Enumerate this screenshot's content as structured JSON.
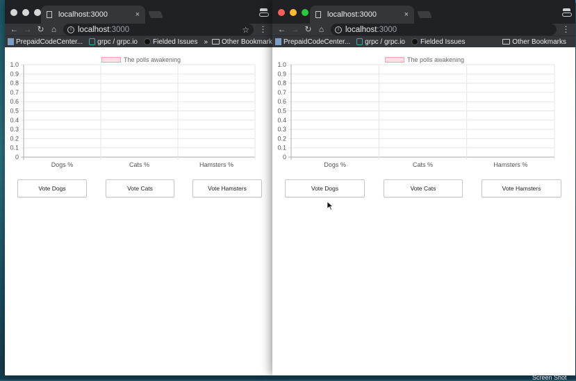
{
  "windows": [
    {
      "id": "left",
      "tab_title": "localhost:3000",
      "tab_close": "×",
      "url_host": "localhost",
      "url_port": ":3000",
      "bookmarks": [
        "PrepaidCodeCenter...",
        "grpc / grpc.io",
        "Fielded Issues"
      ],
      "overflow": "»",
      "other_bookmarks": "Other Bookmarks",
      "legend_label": "The polls awakening",
      "buttons": [
        "Vote Dogs",
        "Vote Cats",
        "Vote Hamsters"
      ]
    },
    {
      "id": "right",
      "tab_title": "localhost:3000",
      "tab_close": "×",
      "url_host": "localhost",
      "url_port": ":3000",
      "bookmarks": [
        "PrepaidCodeCenter...",
        "grpc / grpc.io",
        "Fielded Issues"
      ],
      "other_bookmarks": "Other Bookmarks",
      "legend_label": "The polls awakening",
      "buttons": [
        "Vote Dogs",
        "Vote Cats",
        "Vote Hamsters"
      ]
    }
  ],
  "chart_data": [
    {
      "type": "bar",
      "categories": [
        "Dogs %",
        "Cats %",
        "Hamsters %"
      ],
      "series": [
        {
          "name": "The polls awakening",
          "values": [
            0,
            0,
            0
          ]
        }
      ],
      "ylim": [
        0,
        1.0
      ],
      "yticks": [
        "0",
        "0.1",
        "0.2",
        "0.3",
        "0.4",
        "0.5",
        "0.6",
        "0.7",
        "0.8",
        "0.9",
        "1.0"
      ],
      "grid": true,
      "legend": "top-center",
      "colors": {
        "fill": "#ffe0e6",
        "border": "#ff9fb0"
      }
    },
    {
      "type": "bar",
      "categories": [
        "Dogs %",
        "Cats %",
        "Hamsters %"
      ],
      "series": [
        {
          "name": "The polls awakening",
          "values": [
            0,
            0,
            0
          ]
        }
      ],
      "ylim": [
        0,
        1.0
      ],
      "yticks": [
        "0",
        "0.1",
        "0.2",
        "0.3",
        "0.4",
        "0.5",
        "0.6",
        "0.7",
        "0.8",
        "0.9",
        "1.0"
      ],
      "grid": true,
      "legend": "top-center",
      "colors": {
        "fill": "#ffe0e6",
        "border": "#ff9fb0"
      }
    }
  ],
  "colors": {
    "chrome_dark": "#1f2124",
    "chrome_toolbar": "#35363a",
    "traffic_red": "#ff5f57",
    "traffic_yellow": "#febc2e",
    "traffic_green": "#28c840",
    "inactive_dot": "#d6d6d6"
  },
  "desktop": {
    "screenshot_label": "Screen Shot"
  }
}
